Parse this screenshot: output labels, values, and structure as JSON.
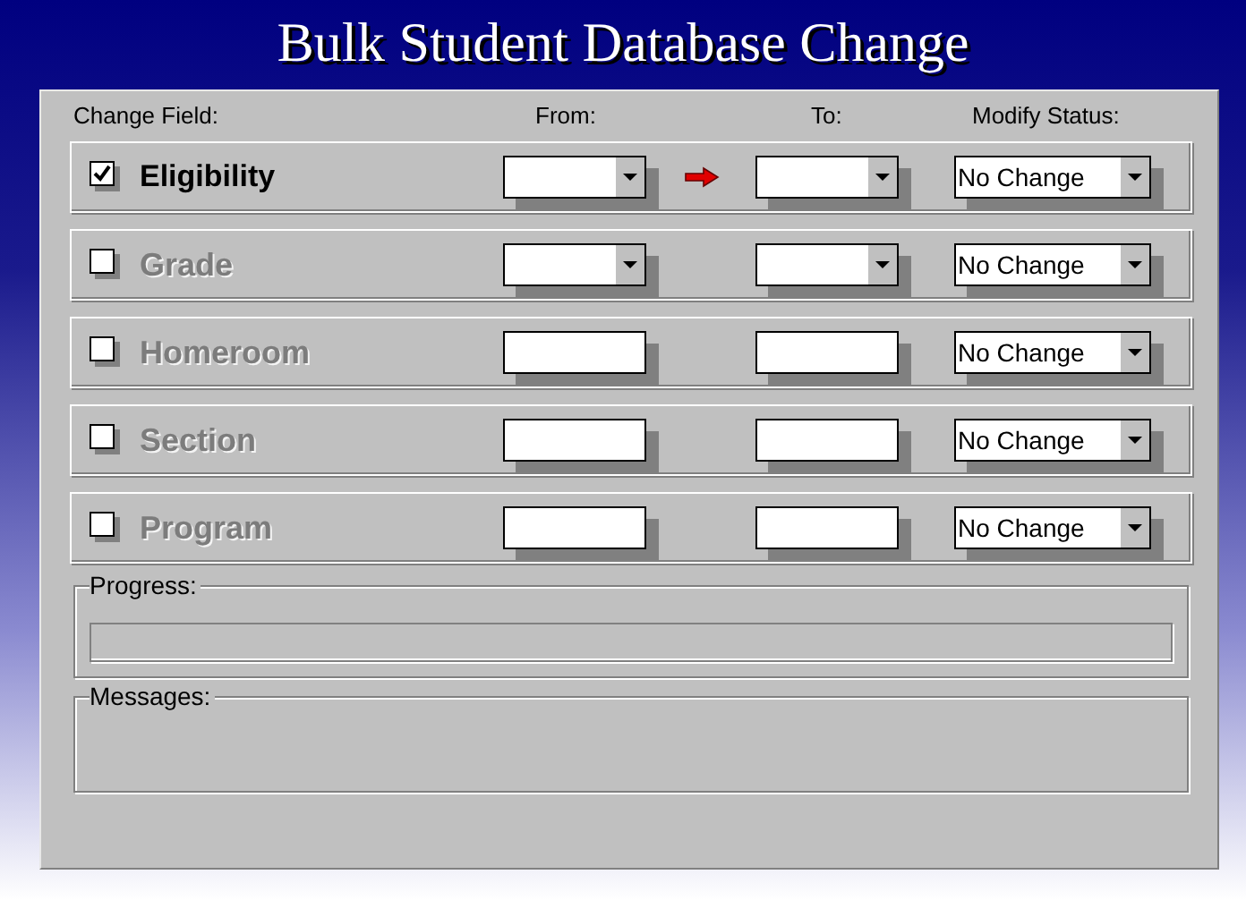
{
  "window": {
    "title": "Bulk Student Database Change"
  },
  "columns": [
    "Change Field:",
    "From:",
    "To:",
    "Modify Status:"
  ],
  "fields": [
    {
      "label": "Eligibility",
      "checked": true,
      "kind": "dropdown",
      "arrow": true,
      "status": "No Change"
    },
    {
      "label": "Grade",
      "checked": false,
      "kind": "dropdown",
      "arrow": false,
      "status": "No Change"
    },
    {
      "label": "Homeroom",
      "checked": false,
      "kind": "text",
      "arrow": false,
      "status": "No Change"
    },
    {
      "label": "Section",
      "checked": false,
      "kind": "text",
      "arrow": false,
      "status": "No Change"
    },
    {
      "label": "Program",
      "checked": false,
      "kind": "text",
      "arrow": false,
      "status": "No Change"
    }
  ],
  "progress": {
    "label": "Progress:",
    "level": 0
  },
  "messages": {
    "label": "Messages:"
  }
}
